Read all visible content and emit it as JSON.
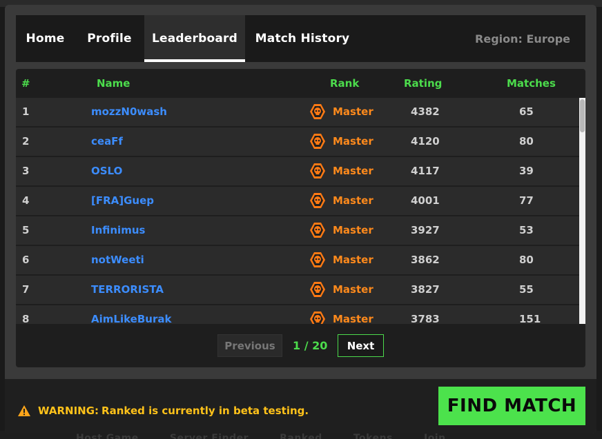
{
  "nav": {
    "tabs": [
      {
        "label": "Home"
      },
      {
        "label": "Profile"
      },
      {
        "label": "Leaderboard"
      },
      {
        "label": "Match History"
      }
    ],
    "region": "Region: Europe"
  },
  "table": {
    "headers": {
      "num": "#",
      "name": "Name",
      "rank": "Rank",
      "rating": "Rating",
      "matches": "Matches"
    },
    "rows": [
      {
        "num": "1",
        "name": "mozzN0wash",
        "rank": "Master",
        "rating": "4382",
        "matches": "65"
      },
      {
        "num": "2",
        "name": "ceaFf",
        "rank": "Master",
        "rating": "4120",
        "matches": "80"
      },
      {
        "num": "3",
        "name": "OSLO",
        "rank": "Master",
        "rating": "4117",
        "matches": "39"
      },
      {
        "num": "4",
        "name": "[FRA]Guep",
        "rank": "Master",
        "rating": "4001",
        "matches": "77"
      },
      {
        "num": "5",
        "name": "Infinimus",
        "rank": "Master",
        "rating": "3927",
        "matches": "53"
      },
      {
        "num": "6",
        "name": "notWeeti",
        "rank": "Master",
        "rating": "3862",
        "matches": "80"
      },
      {
        "num": "7",
        "name": "TERRORISTA",
        "rank": "Master",
        "rating": "3827",
        "matches": "55"
      },
      {
        "num": "8",
        "name": "AimLikeBurak",
        "rank": "Master",
        "rating": "3783",
        "matches": "151"
      }
    ]
  },
  "pager": {
    "previous": "Previous",
    "page": "1 / 20",
    "next": "Next"
  },
  "footer": {
    "warning_label": "WARNING:",
    "warning_text": "Ranked is currently in beta testing.",
    "find_match": "FIND MATCH"
  },
  "background": {
    "items": [
      "Host Game",
      "Server Finder",
      "Ranked",
      "Tokens",
      "Join"
    ]
  },
  "icons": {
    "rank_badge": "skull-badge-icon",
    "warning": "warning-triangle-icon"
  },
  "colors": {
    "accent_green": "#4ce24c",
    "header_green": "#4cdc4c",
    "name_blue": "#3c8dff",
    "rank_orange": "#ff8a1c",
    "warning_yellow": "#ffc21a"
  }
}
